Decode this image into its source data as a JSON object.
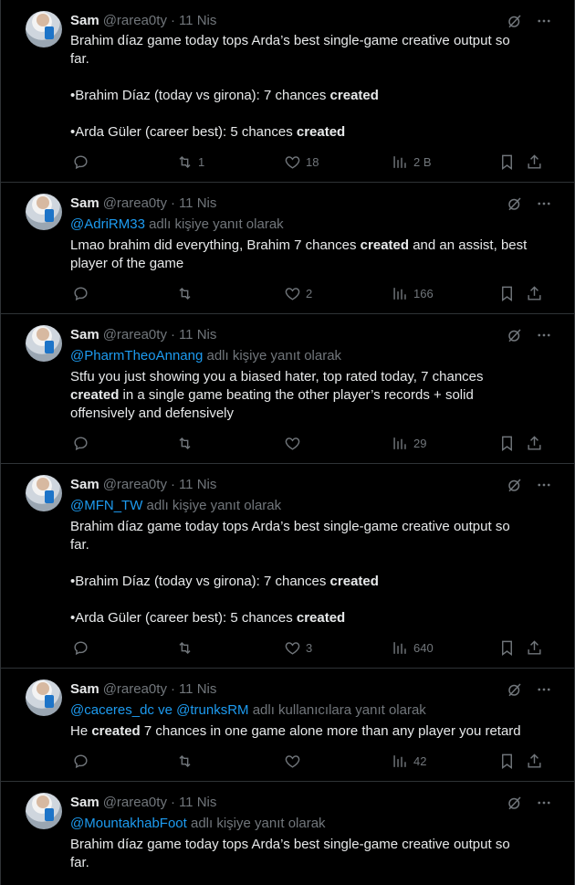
{
  "tweets": [
    {
      "name": "Sam",
      "handle": "@rarea0ty",
      "date": "11 Nis",
      "reply_to": null,
      "body_lines": [
        [
          "Brahim díaz game today tops Arda’s best single-game creative output so far.",
          null
        ],
        [
          "",
          null
        ],
        [
          "•Brahim Díaz (today vs girona): 7 chances ",
          "created"
        ],
        [
          "",
          null
        ],
        [
          "•Arda Güler (career best): 5 chances ",
          "created"
        ]
      ],
      "stats": {
        "replies": "",
        "retweets": "1",
        "likes": "18",
        "views": "2 B"
      }
    },
    {
      "name": "Sam",
      "handle": "@rarea0ty",
      "date": "11 Nis",
      "reply_to": {
        "mentions": "@AdriRM33",
        "suffix": " adlı kişiye yanıt olarak"
      },
      "body_html": [
        "Lmao brahim did everything, Brahim 7 chances ",
        "created",
        " and an assist, best player of the game"
      ],
      "stats": {
        "replies": "",
        "retweets": "",
        "likes": "2",
        "views": "166"
      }
    },
    {
      "name": "Sam",
      "handle": "@rarea0ty",
      "date": "11 Nis",
      "reply_to": {
        "mentions": "@PharmTheoAnnang",
        "suffix": " adlı kişiye yanıt olarak"
      },
      "body_html": [
        "Stfu you just showing you a biased hater, top rated today, 7 chances ",
        "created",
        " in a single game beating the other player’s records + solid offensively and defensively"
      ],
      "stats": {
        "replies": "",
        "retweets": "",
        "likes": "",
        "views": "29"
      }
    },
    {
      "name": "Sam",
      "handle": "@rarea0ty",
      "date": "11 Nis",
      "reply_to": {
        "mentions": "@MFN_TW",
        "suffix": " adlı kişiye yanıt olarak"
      },
      "body_lines": [
        [
          "Brahim díaz game today tops Arda’s best single-game creative output so far.",
          null
        ],
        [
          "",
          null
        ],
        [
          "•Brahim Díaz (today vs girona): 7 chances ",
          "created"
        ],
        [
          "",
          null
        ],
        [
          "•Arda Güler (career best): 5 chances ",
          "created"
        ]
      ],
      "stats": {
        "replies": "",
        "retweets": "",
        "likes": "3",
        "views": "640"
      }
    },
    {
      "name": "Sam",
      "handle": "@rarea0ty",
      "date": "11 Nis",
      "reply_to": {
        "mentions": "@caceres_dc ve @trunksRM",
        "suffix": " adlı kullanıcılara yanıt olarak"
      },
      "body_html": [
        "He ",
        "created",
        " 7 chances in one game alone more than any player you retard"
      ],
      "stats": {
        "replies": "",
        "retweets": "",
        "likes": "",
        "views": "42"
      }
    },
    {
      "name": "Sam",
      "handle": "@rarea0ty",
      "date": "11 Nis",
      "reply_to": {
        "mentions": "@MountakhabFoot",
        "suffix": " adlı kişiye yanıt olarak"
      },
      "body_lines": [
        [
          "Brahim díaz game today tops Arda’s best single-game creative output so far.",
          null
        ]
      ],
      "stats": null
    }
  ],
  "icons": {
    "grok": "grok-icon",
    "more": "more-icon",
    "reply": "reply-icon",
    "retweet": "retweet-icon",
    "like": "like-icon",
    "views": "views-icon",
    "bookmark": "bookmark-icon",
    "share": "share-icon"
  },
  "colors": {
    "background": "#000000",
    "text": "#e7e9ea",
    "muted": "#71767b",
    "link": "#1d9bf0",
    "border": "#2f3336"
  }
}
